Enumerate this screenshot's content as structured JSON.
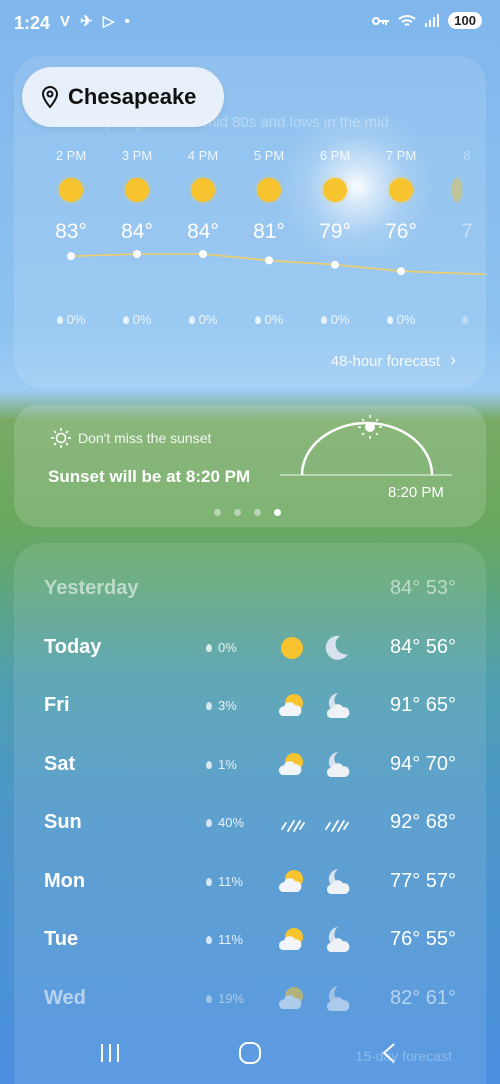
{
  "status": {
    "time": "1:24",
    "left_icons": "V ✈ ▷ •",
    "battery": "100"
  },
  "header": {
    "faded_text": "Today: Highs in the mid 80s and lows in the mid",
    "location": "Chesapeake"
  },
  "hourly": [
    {
      "time": "2 PM",
      "temp": "83°",
      "precip": "0%"
    },
    {
      "time": "3 PM",
      "temp": "84°",
      "precip": "0%"
    },
    {
      "time": "4 PM",
      "temp": "84°",
      "precip": "0%"
    },
    {
      "time": "5 PM",
      "temp": "81°",
      "precip": "0%"
    },
    {
      "time": "6 PM",
      "temp": "79°",
      "precip": "0%"
    },
    {
      "time": "7 PM",
      "temp": "76°",
      "precip": "0%"
    },
    {
      "time": "8",
      "temp": "7",
      "precip": ""
    }
  ],
  "forecast_48_label": "48-hour forecast",
  "sunset": {
    "heading": "Don't miss the sunset",
    "text": "Sunset will be at 8:20 PM",
    "time": "8:20 PM",
    "page_count": 4,
    "active_page": 4
  },
  "daily": [
    {
      "day": "Yesterday",
      "precip": "",
      "day_icon": "",
      "night_icon": "",
      "temps": "84° 53°"
    },
    {
      "day": "Today",
      "precip": "0%",
      "day_icon": "sun-icon",
      "night_icon": "moon-icon",
      "temps": "84° 56°"
    },
    {
      "day": "Fri",
      "precip": "3%",
      "day_icon": "partly-cloudy-icon",
      "night_icon": "partly-cloudy-night-icon",
      "temps": "91° 65°"
    },
    {
      "day": "Sat",
      "precip": "1%",
      "day_icon": "partly-cloudy-icon",
      "night_icon": "partly-cloudy-night-icon",
      "temps": "94° 70°"
    },
    {
      "day": "Sun",
      "precip": "40%",
      "day_icon": "rain-icon",
      "night_icon": "rain-icon",
      "temps": "92° 68°"
    },
    {
      "day": "Mon",
      "precip": "11%",
      "day_icon": "partly-cloudy-icon",
      "night_icon": "partly-cloudy-night-icon",
      "temps": "77° 57°"
    },
    {
      "day": "Tue",
      "precip": "11%",
      "day_icon": "partly-cloudy-icon",
      "night_icon": "partly-cloudy-night-icon",
      "temps": "76° 55°"
    },
    {
      "day": "Wed",
      "precip": "19%",
      "day_icon": "partly-cloudy-icon",
      "night_icon": "partly-cloudy-night-icon",
      "temps": "82° 61°"
    }
  ],
  "forecast_15_label": "15-day forecast",
  "colors": {
    "sun": "#f7c430",
    "moon": "#d7e2ee"
  }
}
